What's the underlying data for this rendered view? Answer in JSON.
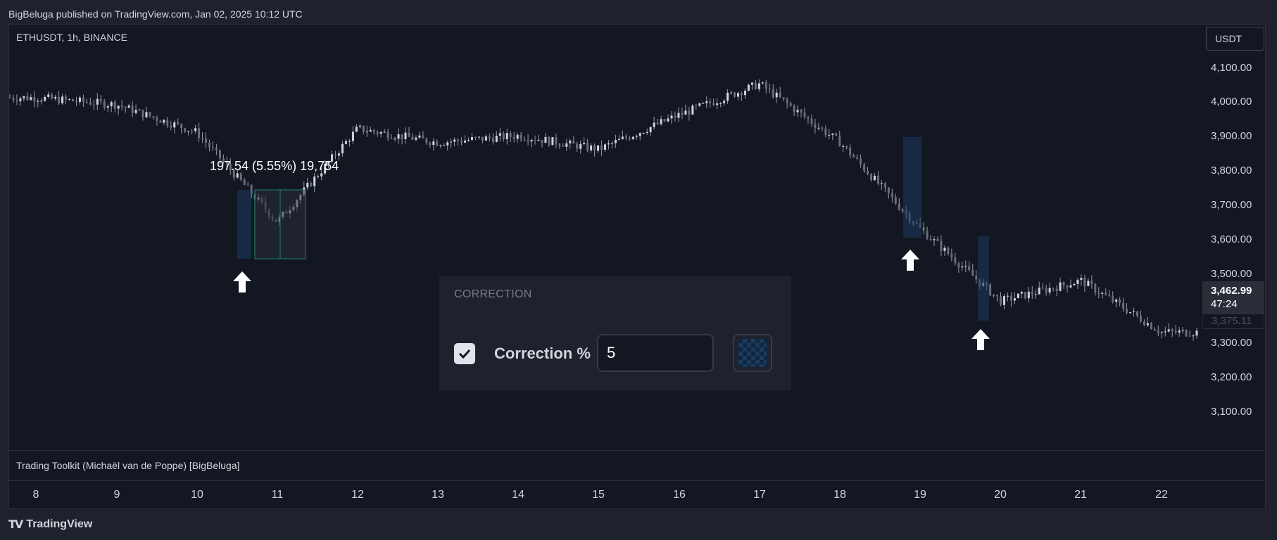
{
  "header": {
    "publish_info": "BigBeluga published on TradingView.com, Jan 02, 2025 10:12 UTC"
  },
  "chart": {
    "symbol": "ETHUSDT, 1h, BINANCE",
    "currency": "USDT",
    "price_labels": [
      "4,100.00",
      "4,000.00",
      "3,900.00",
      "3,800.00",
      "3,700.00",
      "3,600.00",
      "3,500.00",
      "3,300.00",
      "3,200.00",
      "3,100.00"
    ],
    "current_price": "3,462.99",
    "countdown": "47:24",
    "secondary_price": "3,375.11",
    "measure_text": "197.54 (5.55%) 19,754",
    "time_labels": [
      "8",
      "9",
      "10",
      "11",
      "12",
      "13",
      "14",
      "15",
      "16",
      "17",
      "18",
      "19",
      "20",
      "21",
      "22"
    ]
  },
  "chart_data": {
    "type": "candlestick",
    "x": [
      "8",
      "9",
      "10",
      "11",
      "12",
      "13",
      "14",
      "15",
      "16",
      "17",
      "18",
      "19",
      "20",
      "21",
      "22"
    ],
    "series": [
      {
        "values": [
          4010,
          3990,
          3910,
          3650,
          3920,
          3880,
          3900,
          3860,
          3960,
          4050,
          3880,
          3630,
          3420,
          3480,
          3330
        ]
      }
    ],
    "ylim": [
      3070,
      4130
    ]
  },
  "indicator": {
    "name": "Trading Toolkit (Michaël van de Poppe) [BigBeluga]"
  },
  "settings": {
    "section_title": "CORRECTION",
    "label": "Correction %",
    "value": "5",
    "checked": true
  },
  "footer": {
    "brand": "TradingView"
  },
  "colors": {
    "background": "#131722",
    "candle": "#9598a1",
    "highlight": "#1e3a5f",
    "measure": "#1a8a6a"
  }
}
